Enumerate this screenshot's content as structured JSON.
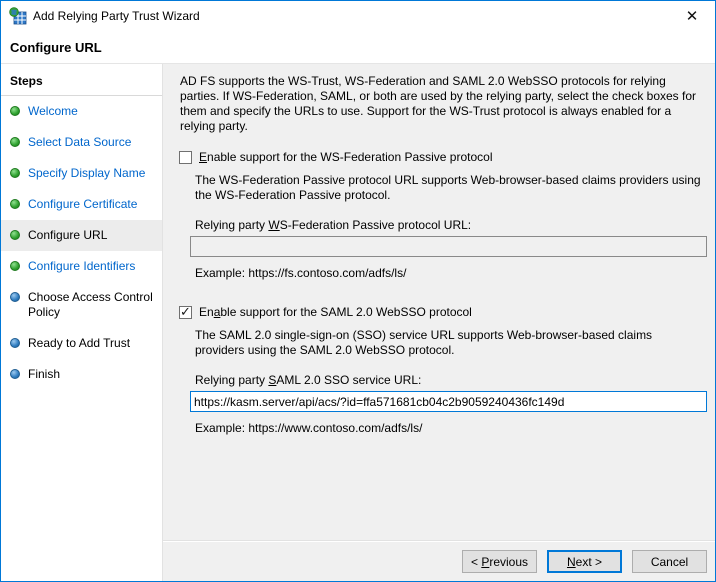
{
  "window": {
    "title": "Add Relying Party Trust Wizard",
    "close_icon": "✕"
  },
  "header": {
    "title": "Configure URL"
  },
  "sidebar": {
    "title": "Steps",
    "items": [
      {
        "label": "Welcome",
        "state": "completed"
      },
      {
        "label": "Select Data Source",
        "state": "completed"
      },
      {
        "label": "Specify Display Name",
        "state": "completed"
      },
      {
        "label": "Configure Certificate",
        "state": "completed"
      },
      {
        "label": "Configure URL",
        "state": "current"
      },
      {
        "label": "Configure Identifiers",
        "state": "completed"
      },
      {
        "label": "Choose Access Control Policy",
        "state": "future"
      },
      {
        "label": "Ready to Add Trust",
        "state": "future"
      },
      {
        "label": "Finish",
        "state": "future"
      }
    ]
  },
  "main": {
    "intro": "AD FS supports the WS-Trust, WS-Federation and SAML 2.0 WebSSO protocols for relying parties.  If WS-Federation, SAML, or both are used by the relying party, select the check boxes for them and specify the URLs to use.  Support for the WS-Trust protocol is always enabled for a relying party.",
    "wsfed": {
      "checkbox": {
        "checked": false,
        "prefix": "",
        "accel": "E",
        "suffix": "nable support for the WS-Federation Passive protocol"
      },
      "description": "The WS-Federation Passive protocol URL supports Web-browser-based claims providers using the WS-Federation Passive protocol.",
      "url_label": {
        "prefix": "Relying party ",
        "accel": "W",
        "suffix": "S-Federation Passive protocol URL:"
      },
      "url_value": "",
      "example": "Example: https://fs.contoso.com/adfs/ls/"
    },
    "saml": {
      "checkbox": {
        "checked": true,
        "prefix": "En",
        "accel": "a",
        "suffix": "ble support for the SAML 2.0 WebSSO protocol"
      },
      "description": "The SAML 2.0 single-sign-on (SSO) service URL supports Web-browser-based claims providers using the SAML 2.0 WebSSO protocol.",
      "url_label": {
        "prefix": "Relying party ",
        "accel": "S",
        "suffix": "AML 2.0 SSO service URL:"
      },
      "url_value": "https://kasm.server/api/acs/?id=ffa571681cb04c2b9059240436fc149d",
      "example": "Example: https://www.contoso.com/adfs/ls/"
    }
  },
  "footer": {
    "previous": {
      "prefix": "< ",
      "accel": "P",
      "suffix": "revious"
    },
    "next": {
      "prefix": "",
      "accel": "N",
      "suffix": "ext >"
    },
    "cancel": "Cancel"
  },
  "colors": {
    "accent_border": "#0078d7",
    "link": "#0066cc",
    "completed_dot_green": "#2fa12f",
    "future_dot_blue": "#2f7cc0",
    "panel_bg": "#f0f0f0",
    "current_step_bg": "#ececec"
  }
}
